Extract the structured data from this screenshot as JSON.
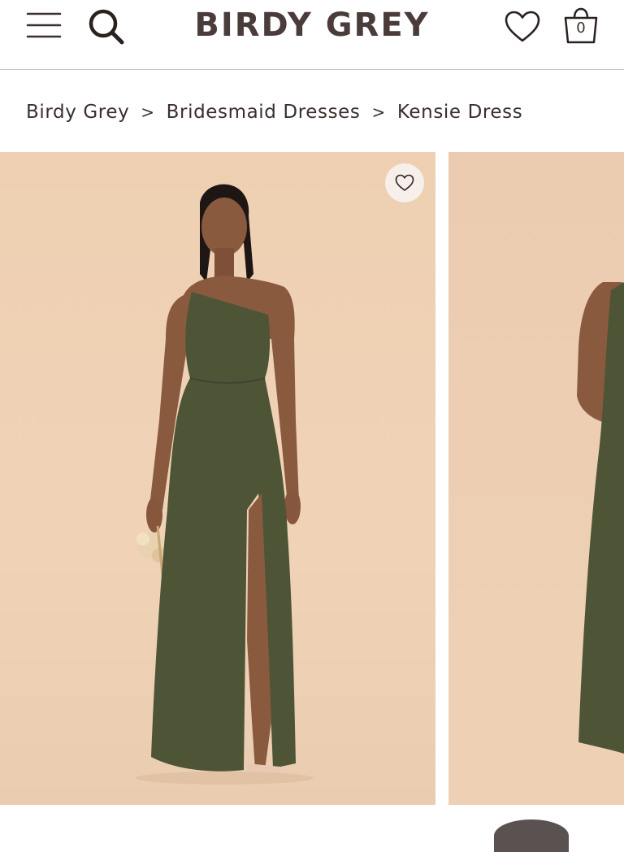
{
  "header": {
    "brand": "BIRDY GREY",
    "cart_count": "0",
    "icons": {
      "menu": "hamburger-menu-icon",
      "search": "search-icon",
      "wishlist": "heart-icon",
      "cart": "shopping-bag-icon"
    }
  },
  "breadcrumb": {
    "items": [
      "Birdy Grey",
      "Bridesmaid Dresses",
      "Kensie Dress"
    ],
    "separator": ">"
  },
  "gallery": {
    "slides": [
      {
        "alt": "Model in olive one-shoulder satin gown with leg slit"
      },
      {
        "alt": "Model in olive satin gown, side view"
      }
    ],
    "favorite_icon": "heart-outline-icon"
  },
  "colors": {
    "brand_text": "#4a3c3a",
    "backdrop": "#eecfb2",
    "dress": "#4e5436"
  }
}
